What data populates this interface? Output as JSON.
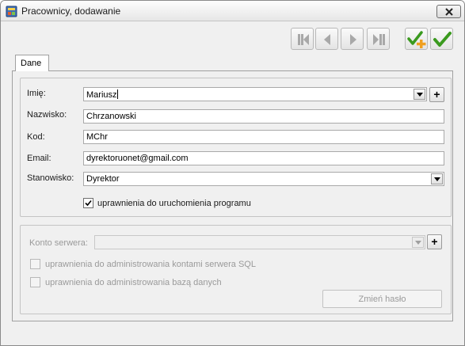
{
  "window": {
    "title": "Pracownicy, dodawanie"
  },
  "toolbar": {
    "icons": [
      "first-record-icon",
      "previous-record-icon",
      "next-record-icon",
      "last-record-icon",
      "save-and-add-icon",
      "save-icon"
    ]
  },
  "tabs": [
    {
      "label": "Dane",
      "active": true
    }
  ],
  "form": {
    "imie": {
      "label": "Imię:",
      "value": "Mariusz"
    },
    "nazwisko": {
      "label": "Nazwisko:",
      "value": "Chrzanowski"
    },
    "kod": {
      "label": "Kod:",
      "value": "MChr"
    },
    "email": {
      "label": "Email:",
      "value": "dyrektoruonet@gmail.com"
    },
    "stanowisko": {
      "label": "Stanowisko:",
      "value": "Dyrektor"
    },
    "program_access": {
      "label": "uprawnienia do uruchomienia programu",
      "checked": true
    }
  },
  "server": {
    "konto": {
      "label": "Konto serwera:",
      "value": ""
    },
    "sql_admin": {
      "label": "uprawnienia do administrowania kontami serwera SQL",
      "checked": false
    },
    "db_admin": {
      "label": "uprawnienia do administrowania bazą danych",
      "checked": false
    },
    "change_password_label": "Zmień hasło"
  },
  "colors": {
    "save_green": "#3a9a1e",
    "add_orange": "#f0a020",
    "nav_gray": "#a8a8a8"
  }
}
